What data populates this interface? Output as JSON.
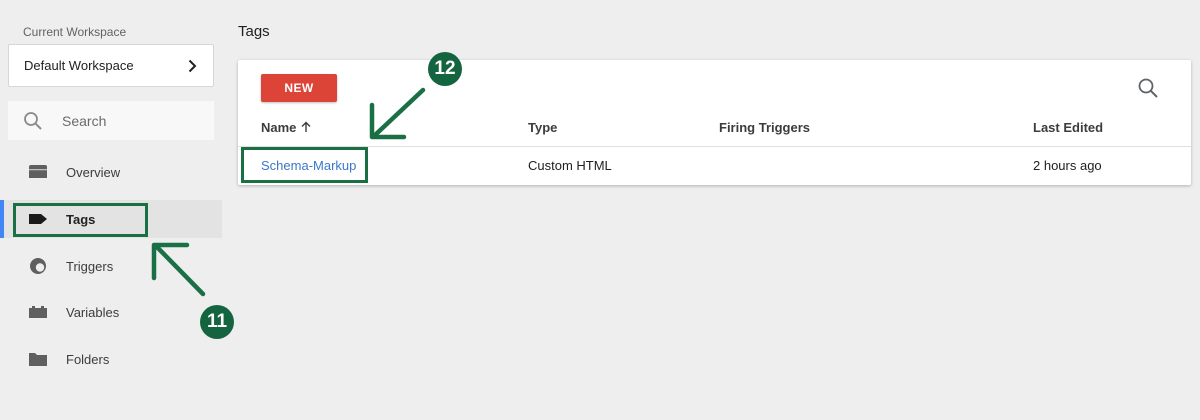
{
  "sidebar": {
    "workspace_caption": "Current Workspace",
    "workspace_name": "Default Workspace",
    "search_label": "Search",
    "items": [
      {
        "label": "Overview",
        "icon": "folder-tab-icon"
      },
      {
        "label": "Tags",
        "icon": "tag-icon",
        "active": true
      },
      {
        "label": "Triggers",
        "icon": "trigger-icon"
      },
      {
        "label": "Variables",
        "icon": "variables-icon"
      },
      {
        "label": "Folders",
        "icon": "folder-icon"
      }
    ]
  },
  "main": {
    "title": "Tags",
    "new_button": "NEW",
    "columns": [
      "Name",
      "Type",
      "Firing Triggers",
      "Last Edited"
    ],
    "rows": [
      {
        "name": "Schema-Markup",
        "type": "Custom HTML",
        "firing_triggers": "",
        "last_edited": "2 hours ago"
      }
    ]
  },
  "annotations": {
    "badge_tags": "11",
    "badge_row": "12"
  },
  "colors": {
    "accent_red": "#db4437",
    "active_bar": "#4285f4",
    "link": "#3b78c8",
    "annotation_green": "#1b6f45"
  }
}
